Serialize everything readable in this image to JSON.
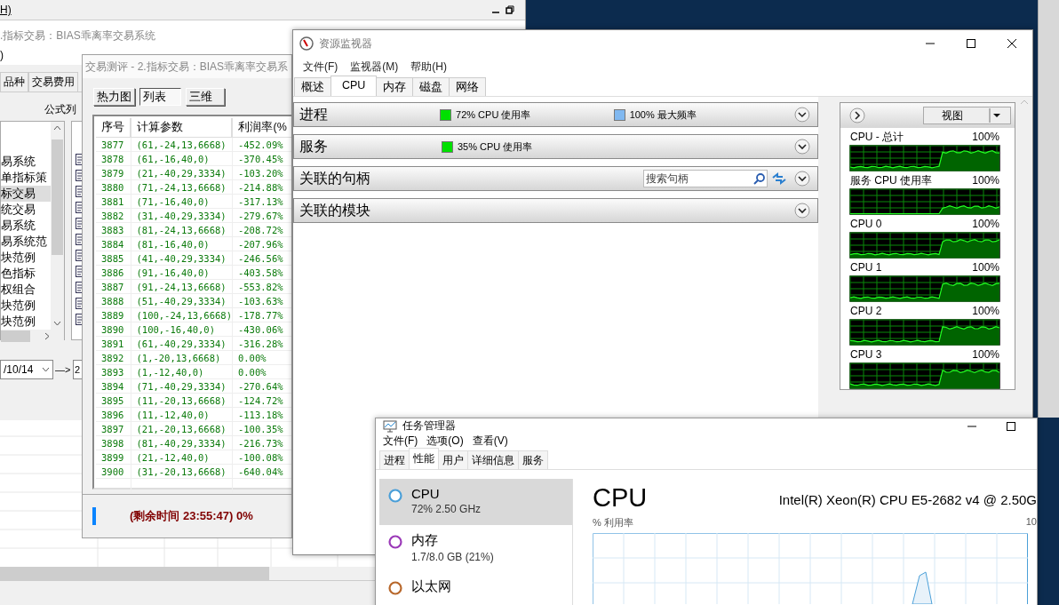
{
  "main_window": {
    "menu_item": "H)",
    "subtitle": ".指标交易：BIAS乖离率交易系统",
    "line_2": ")",
    "tabs": [
      {
        "label": "品种",
        "selected": false
      },
      {
        "label": "交易费用",
        "selected": false
      }
    ],
    "formula_list_label": "公式列",
    "formula_list": [
      {
        "label": "易系统",
        "selected": false
      },
      {
        "label": "单指标策",
        "selected": false
      },
      {
        "label": "标交易",
        "selected": true
      },
      {
        "label": "统交易",
        "selected": false
      },
      {
        "label": "易系统",
        "selected": false
      },
      {
        "label": "易系统范",
        "selected": false
      },
      {
        "label": "块范例",
        "selected": false
      },
      {
        "label": "色指标",
        "selected": false
      },
      {
        "label": "权组合",
        "selected": false
      },
      {
        "label": "块范例",
        "selected": false
      },
      {
        "label": "块范例",
        "selected": false
      }
    ],
    "start_date": "/10/14",
    "arrow": "—>",
    "end_date": "2"
  },
  "trade_dialog": {
    "title": "交易测评 - 2.指标交易：BIAS乖离率交易系",
    "view_tabs": [
      {
        "label": "热力图",
        "selected": false
      },
      {
        "label": "列表",
        "selected": true
      },
      {
        "label": "三维",
        "selected": false
      }
    ],
    "columns": [
      "序号",
      "计算参数",
      "利润率(%"
    ],
    "rows": [
      [
        "3877",
        "(61,-24,13,6668)",
        "-452.09%"
      ],
      [
        "3878",
        "(61,-16,40,0)",
        "-370.45%"
      ],
      [
        "3879",
        "(21,-40,29,3334)",
        "-103.20%"
      ],
      [
        "3880",
        "(71,-24,13,6668)",
        "-214.88%"
      ],
      [
        "3881",
        "(71,-16,40,0)",
        "-317.13%"
      ],
      [
        "3882",
        "(31,-40,29,3334)",
        "-279.67%"
      ],
      [
        "3883",
        "(81,-24,13,6668)",
        "-208.72%"
      ],
      [
        "3884",
        "(81,-16,40,0)",
        "-207.96%"
      ],
      [
        "3885",
        "(41,-40,29,3334)",
        "-246.56%"
      ],
      [
        "3886",
        "(91,-16,40,0)",
        "-403.58%"
      ],
      [
        "3887",
        "(91,-24,13,6668)",
        "-553.82%"
      ],
      [
        "3888",
        "(51,-40,29,3334)",
        "-103.63%"
      ],
      [
        "3889",
        "(100,-24,13,6668)",
        "-178.77%"
      ],
      [
        "3890",
        "(100,-16,40,0)",
        "-430.06%"
      ],
      [
        "3891",
        "(61,-40,29,3334)",
        "-316.28%"
      ],
      [
        "3892",
        "(1,-20,13,6668)",
        "0.00%"
      ],
      [
        "3893",
        "(1,-12,40,0)",
        "0.00%"
      ],
      [
        "3894",
        "(71,-40,29,3334)",
        "-270.64%"
      ],
      [
        "3895",
        "(11,-20,13,6668)",
        "-124.72%"
      ],
      [
        "3896",
        "(11,-12,40,0)",
        "-113.18%"
      ],
      [
        "3897",
        "(21,-20,13,6668)",
        "-100.35%"
      ],
      [
        "3898",
        "(81,-40,29,3334)",
        "-216.73%"
      ],
      [
        "3899",
        "(21,-12,40,0)",
        "-100.08%"
      ],
      [
        "3900",
        "(31,-20,13,6668)",
        "-640.04%"
      ]
    ],
    "status": "(剩余时间 23:55:47) 0%"
  },
  "resource_monitor": {
    "title": "资源监视器",
    "menu": [
      "文件(F)",
      "监视器(M)",
      "帮助(H)"
    ],
    "tabs": [
      {
        "label": "概述",
        "selected": false
      },
      {
        "label": "CPU",
        "selected": true
      },
      {
        "label": "内存",
        "selected": false
      },
      {
        "label": "磁盘",
        "selected": false
      },
      {
        "label": "网络",
        "selected": false
      }
    ],
    "sections": [
      {
        "kind": "summary",
        "title": "进程",
        "expanded": false,
        "legends": [
          {
            "label": "72% CPU 使用率",
            "color": "#00e000"
          },
          {
            "label": "100% 最大频率",
            "color": "#80b8f0"
          }
        ]
      },
      {
        "kind": "summary",
        "title": "服务",
        "expanded": false,
        "legends": [
          {
            "label": "35% CPU 使用率",
            "color": "#00e000"
          }
        ]
      },
      {
        "kind": "search",
        "title": "关联的句柄",
        "expanded": false,
        "placeholder": "搜索句柄"
      },
      {
        "kind": "plain",
        "title": "关联的模块",
        "expanded": false
      }
    ],
    "view_button": "视图",
    "graphs": [
      {
        "label": "CPU - 总计",
        "value": "100%"
      },
      {
        "label": "服务 CPU 使用率",
        "value": "100%"
      },
      {
        "label": "CPU 0",
        "value": "100%"
      },
      {
        "label": "CPU 1",
        "value": "100%"
      },
      {
        "label": "CPU 2",
        "value": "100%"
      },
      {
        "label": "CPU 3",
        "value": "100%"
      }
    ]
  },
  "task_manager": {
    "title": "任务管理器",
    "menu": [
      "文件(F)",
      "选项(O)",
      "查看(V)"
    ],
    "tabs": [
      {
        "label": "进程",
        "selected": false
      },
      {
        "label": "性能",
        "selected": true
      },
      {
        "label": "用户",
        "selected": false
      },
      {
        "label": "详细信息",
        "selected": false
      },
      {
        "label": "服务",
        "selected": false
      }
    ],
    "resources": [
      {
        "name": "CPU",
        "detail": "72% 2.50 GHz",
        "selected": true,
        "color": "#4a9fd8"
      },
      {
        "name": "内存",
        "detail": "1.7/8.0 GB (21%)",
        "selected": false,
        "color": "#9b3ab8"
      },
      {
        "name": "以太网",
        "selected": false,
        "color": "#b8682c"
      }
    ],
    "heading": "CPU",
    "processor": "Intel(R) Xeon(R) CPU E5-2682 v4 @ 2.50G",
    "chart_label": "% 利用率",
    "chart_max": "10"
  }
}
